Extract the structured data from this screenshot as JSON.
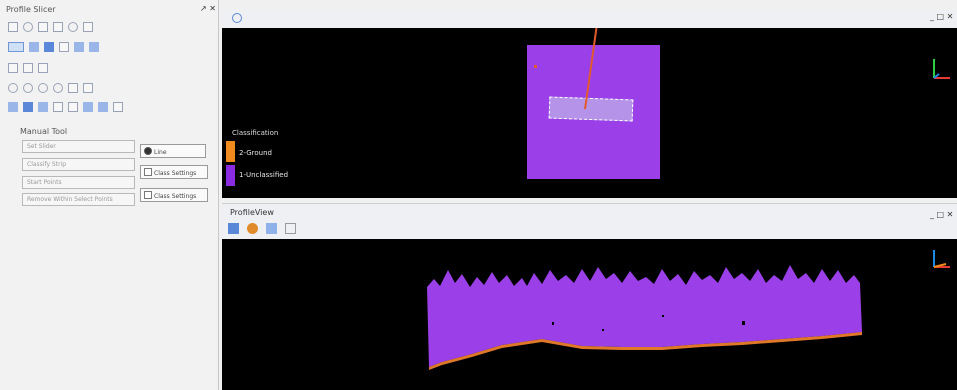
{
  "left_panel": {
    "title": "Profile Slicer",
    "controls": "↗ ✕",
    "group_title": "Manual Tool",
    "buttons": [
      {
        "label": "Set Slider"
      },
      {
        "label": "Classify Strip"
      },
      {
        "label": "Start Points"
      },
      {
        "label": "Remove Within Select Points"
      }
    ],
    "side_controls": [
      {
        "label": "Line"
      },
      {
        "label": "Class Settings"
      },
      {
        "label": "Class Settings"
      }
    ]
  },
  "view_top": {
    "header_icon": "globe-icon",
    "controls": "_ □ ✕",
    "legend": {
      "title": "Classification",
      "items": [
        {
          "label": "2-Ground",
          "color": "#f08a1c"
        },
        {
          "label": "1-Unclassified",
          "color": "#8a2be2"
        }
      ]
    }
  },
  "view_bottom": {
    "title": "ProfileView",
    "controls": "_ □ ✕"
  },
  "colors": {
    "point_cloud": "#9b3fe8",
    "ground": "#e0782a",
    "background": "#000000"
  }
}
